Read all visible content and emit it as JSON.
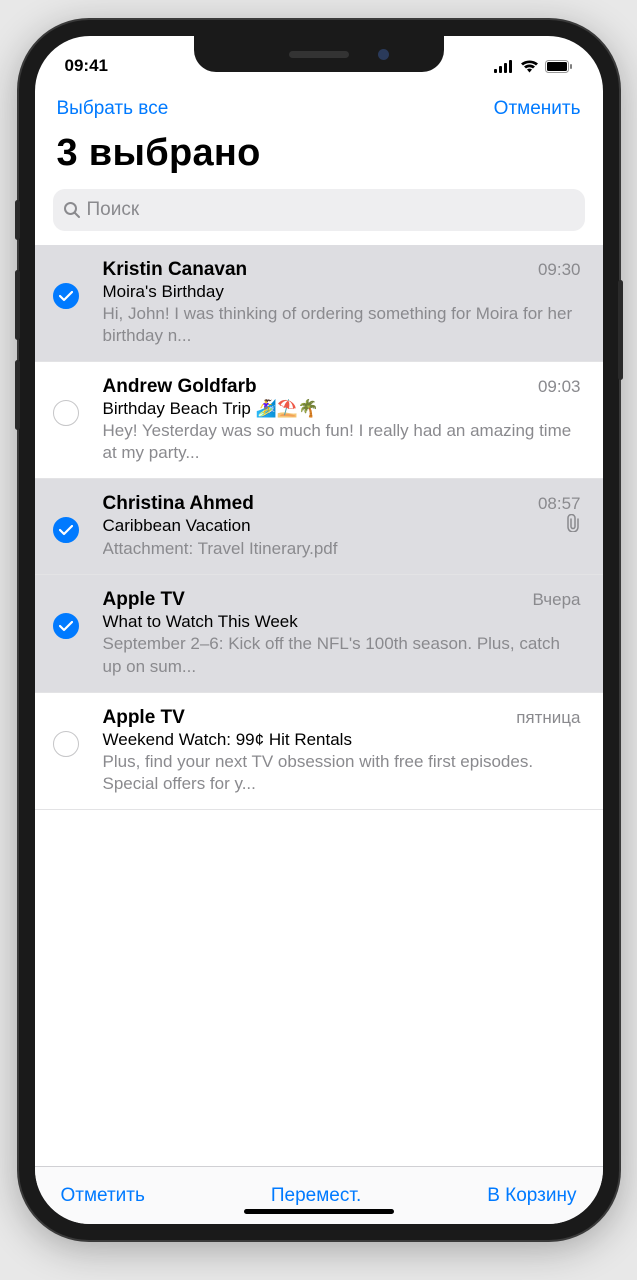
{
  "status": {
    "time": "09:41"
  },
  "nav": {
    "select_all": "Выбрать все",
    "cancel": "Отменить"
  },
  "title": "3 выбрано",
  "search": {
    "placeholder": "Поиск"
  },
  "toolbar": {
    "mark": "Отметить",
    "move": "Перемест.",
    "trash": "В Корзину"
  },
  "messages": [
    {
      "sender": "Kristin Canavan",
      "time": "09:30",
      "subject": "Moira's Birthday",
      "preview": "Hi, John! I was thinking of ordering something for Moira for her birthday n...",
      "selected": true,
      "attachment": false
    },
    {
      "sender": "Andrew Goldfarb",
      "time": "09:03",
      "subject": "Birthday Beach Trip 🏄‍♀️⛱️🌴",
      "preview": "Hey! Yesterday was so much fun! I really had an amazing time at my party...",
      "selected": false,
      "attachment": false
    },
    {
      "sender": "Christina Ahmed",
      "time": "08:57",
      "subject": "Caribbean Vacation",
      "preview": "Attachment: Travel Itinerary.pdf",
      "selected": true,
      "attachment": true
    },
    {
      "sender": "Apple TV",
      "time": "Вчера",
      "subject": "What to Watch This Week",
      "preview": "September 2–6: Kick off the NFL's 100th season. Plus, catch up on sum...",
      "selected": true,
      "attachment": false
    },
    {
      "sender": "Apple TV",
      "time": "пятница",
      "subject": "Weekend Watch: 99¢ Hit Rentals",
      "preview": "Plus, find your next TV obsession with free first episodes. Special offers for y...",
      "selected": false,
      "attachment": false
    }
  ]
}
